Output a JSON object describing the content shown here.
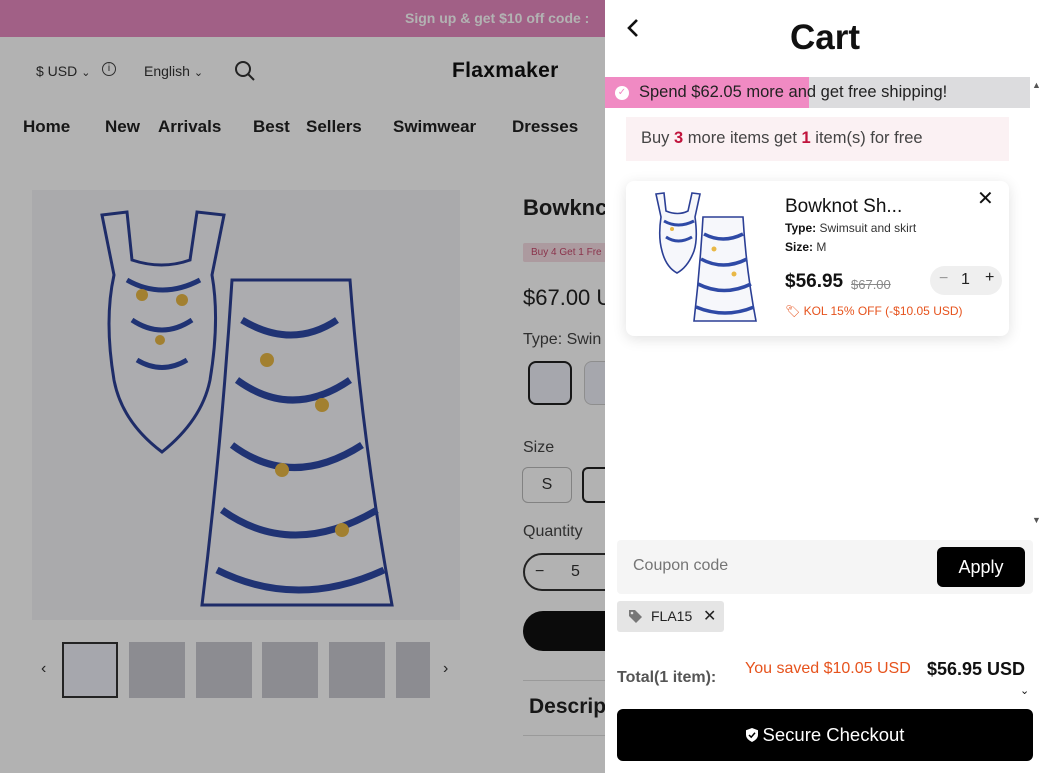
{
  "background_page": {
    "promo_text": "Sign up & get $10 off code :",
    "currency": "$ USD",
    "language": "English",
    "logo": "Flaxmaker",
    "nav": [
      "Home",
      "New",
      "Arrivals",
      "Best",
      "Sellers",
      "Swimwear",
      "Dresses"
    ],
    "product_title": "Bowknc",
    "promo_badge": "Buy 4 Get 1 Fre",
    "price": "$67.00 U",
    "type_label": "Type: Swin",
    "size_label": "Size",
    "sizes": [
      "S"
    ],
    "quantity_label": "Quantity",
    "quantity": "5",
    "description_label": "Descrip"
  },
  "cart": {
    "title": "Cart",
    "shipping_message": "Spend $62.05 more and get free shipping!",
    "shipping_progress": 0.48,
    "free_items_prefix": "Buy ",
    "free_items_count": "3",
    "free_items_middle": " more items get ",
    "free_items_free": "1",
    "free_items_suffix": " item(s) for free",
    "item": {
      "name": "Bowknot Sh...",
      "type_label": "Type:",
      "type_value": "Swimsuit and skirt",
      "size_label": "Size:",
      "size_value": "M",
      "price": "$56.95",
      "original_price": "$67.00",
      "quantity": "1",
      "discount": "KOL 15% OFF (-$10.05 USD)"
    },
    "coupon_placeholder": "Coupon code",
    "apply_label": "Apply",
    "applied_coupon": "FLA15",
    "total_label": "Total(1 item):",
    "saved_text": "You saved $10.05 USD",
    "total_amount": "$56.95 USD",
    "checkout_label": "Secure Checkout"
  },
  "colors": {
    "promo_pink": "#e78ac0",
    "shipping_fill": "#f08ac3",
    "discount_orange": "#e6531d",
    "count_red": "#c0143c"
  }
}
